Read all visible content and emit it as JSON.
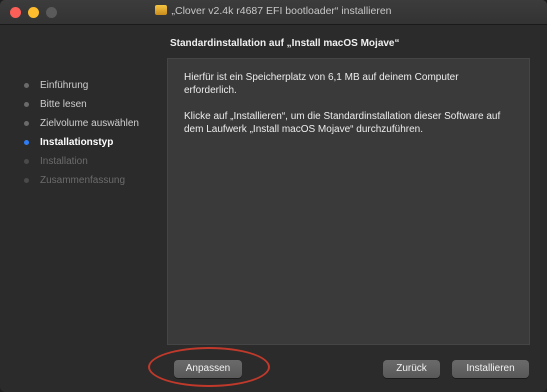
{
  "window": {
    "title": "„Clover v2.4k r4687 EFI bootloader“ installieren",
    "icon": "package-icon"
  },
  "heading": "Standardinstallation auf „Install macOS Mojave“",
  "sidebar": {
    "steps": [
      {
        "label": "Einführung",
        "state": "done"
      },
      {
        "label": "Bitte lesen",
        "state": "done"
      },
      {
        "label": "Zielvolume auswählen",
        "state": "done"
      },
      {
        "label": "Installationstyp",
        "state": "active"
      },
      {
        "label": "Installation",
        "state": "pending"
      },
      {
        "label": "Zusammenfassung",
        "state": "pending"
      }
    ]
  },
  "content": {
    "paragraph1": "Hierfür ist ein Speicherplatz von 6,1 MB auf deinem Computer erforderlich.",
    "paragraph2": "Klicke auf „Installieren“, um die Standardinstallation dieser Software auf dem Laufwerk „Install macOS Mojave“ durchzuführen."
  },
  "buttons": {
    "customize": "Anpassen",
    "back": "Zurück",
    "install": "Installieren"
  },
  "colors": {
    "accent": "#2f7df6",
    "annotation": "#c0392b"
  }
}
